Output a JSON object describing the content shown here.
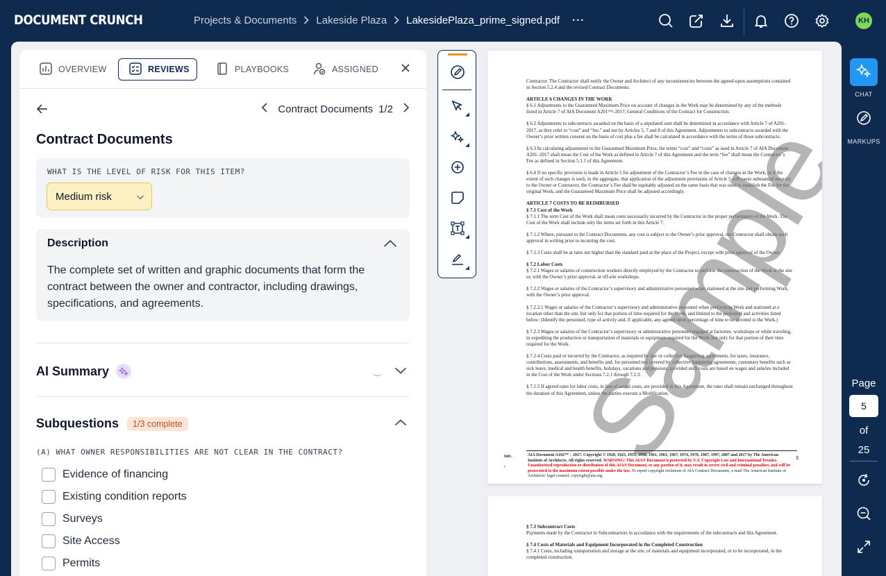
{
  "app": {
    "logo": "DOCUMENT CRUNCH",
    "breadcrumb": [
      "Projects & Documents",
      "Lakeside Plaza",
      "LakesidePlaza_prime_signed.pdf"
    ],
    "more": "···",
    "user_initials": "KH"
  },
  "panel": {
    "tabs": [
      {
        "label": "OVERVIEW",
        "icon": "chart-icon"
      },
      {
        "label": "REVIEWS",
        "icon": "review-icon"
      },
      {
        "label": "PLAYBOOKS",
        "icon": "book-icon"
      },
      {
        "label": "ASSIGNED",
        "icon": "user-check-icon"
      }
    ],
    "active_tab": "REVIEWS",
    "pager_label": "Contract Documents",
    "pager_count": "1/2",
    "title": "Contract Documents",
    "risk_question": "WHAT IS THE LEVEL OF RISK FOR THIS ITEM?",
    "risk_value": "Medium risk",
    "description_heading": "Description",
    "description_text": "The complete set of written and graphic documents that form the contract between the owner and contractor, including drawings, specifications, and agreements.",
    "ai_summary_heading": "AI Summary",
    "subquestions_heading": "Subquestions",
    "subquestions_badge": "1/3 complete",
    "subquestion_a": "(A) WHAT OWNER RESPONSIBILITIES ARE NOT CLEAR IN THE CONTRACT?",
    "checklist": [
      "Evidence of financing",
      "Existing condition reports",
      "Surveys",
      "Site Access",
      "Permits"
    ]
  },
  "document": {
    "watermark": "Sample",
    "page1_paragraphs": [
      "Contractor. The Contractor shall notify the Owner and Architect of any inconsistencies between the agreed-upon assumptions contained in Section 5.2.4 and the revised Contract Documents.",
      "ARTICLE 6   CHANGES IN THE WORK",
      "§ 6.1 Adjustments to the Guaranteed Maximum Price on account of changes in the Work may be determined by any of the methods listed in Article 7 of AIA Document A201™–2017, General Conditions of the Contract for Construction.",
      "§ 6.2 Adjustments to subcontracts awarded on the basis of a stipulated sum shall be determined in accordance with Article 7 of A201–2017, as they refer to “cost” and “fee,” and not by Articles 5, 7 and 8 of this Agreement. Adjustments to subcontracts awarded with the Owner’s prior written consent on the basis of cost plus a fee shall be calculated in accordance with the terms of those subcontracts.",
      "§ 6.3 In calculating adjustments to the Guaranteed Maximum Price, the terms “cost” and “costs” as used in Article 7 of AIA Document A201–2017 shall mean the Cost of the Work as defined in Article 7 of this Agreement and the term “fee” shall mean the Contractor’s Fee as defined in Section 5.1.1 of this Agreement.",
      "§ 6.4 If no specific provision is made in Article 5 for adjustment of the Contractor’s Fee in the case of changes in the Work, or if the extent of such changes is such, in the aggregate, that application of the adjustment provisions of Article 5 will cause substantial inequity to the Owner or Contractor, the Contractor’s Fee shall be equitably adjusted on the same basis that was used to establish the Fee for the original Work, and the Guaranteed Maximum Price shall be adjusted accordingly.",
      "ARTICLE 7   COSTS TO BE REIMBURSED",
      "§ 7.1 Cost of the Work",
      "§ 7.1.1 The term Cost of the Work shall mean costs necessarily incurred by the Contractor in the proper performance of the Work. The Cost of the Work shall include only the items set forth in this Article 7.",
      "§ 7.1.2 Where, pursuant to the Contract Documents, any cost is subject to the Owner’s prior approval, the Contractor shall obtain such approval in writing prior to incurring the cost.",
      "§ 7.1.3 Costs shall be at rates not higher than the standard paid at the place of the Project, except with prior approval of the Owner.",
      "§ 7.2 Labor Costs",
      "§ 7.2.1 Wages or salaries of construction workers directly employed by the Contractor to perform the construction of the Work at the site or, with the Owner’s prior approval, at off-site workshops.",
      "§ 7.2.2 Wages or salaries of the Contractor’s supervisory and administrative personnel when stationed at the site and performing Work, with the Owner’s prior approval.",
      "§ 7.2.2.1 Wages or salaries of the Contractor’s supervisory and administrative personnel when performing Work and stationed at a location other than the site, but only for that portion of time required for the Work, and limited to the personnel and activities listed below: (Identify the personnel, type of activity and, if applicable, any agreed upon percentage of time to be devoted to the Work.)",
      "§ 7.2.3 Wages or salaries of the Contractor’s supervisory or administrative personnel engaged at factories, workshops or while traveling, in expediting the production or transportation of materials or equipment required for the Work, but only for that portion of their time required for the Work.",
      "§ 7.2.4 Costs paid or incurred by the Contractor, as required by law or collective bargaining agreements, for taxes, insurance, contributions, assessments, and benefits and, for personnel not covered by collective bargaining agreements, customary benefits such as sick leave, medical and health benefits, holidays, vacations and pensions, provided such costs are based on wages and salaries included in the Cost of the Work under Sections 7.2.1 through 7.2.3.",
      "§ 7.2.5 If agreed rates for labor costs, in lieu of actual costs, are provided in this Agreement, the rates shall remain unchanged throughout the duration of this Agreement, unless the parties execute a Modification."
    ],
    "footer_init": "Init.",
    "footer_slash": "/",
    "footer_text": "AIA Document A102™ – 2017. Copyright © 1920, 1925, 1951, 1958, 1961, 1963, 1967, 1974, 1978, 1987, 1997, 2007 and 2017 by The American Institute of Architects. All rights reserved.",
    "footer_warning": "WARNING: This AIA® Document is protected by U.S. Copyright Law and International Treaties. Unauthorized reproduction or distribution of this AIA® Document, or any portion of it, may result in severe civil and criminal penalties, and will be prosecuted to the maximum extent possible under the law.",
    "footer_tail": "To report copyright violations of AIA Contract Documents, e-mail The American Institute of Architects’ legal counsel, copyright@aia.org.",
    "page_number": "5",
    "page2_paragraphs": [
      "§ 7.3 Subcontract Costs",
      "Payments made by the Contractor to Subcontractors in accordance with the requirements of the subcontracts and this Agreement.",
      "§ 7.4 Costs of Materials and Equipment Incorporated in the Completed Construction",
      "§ 7.4.1 Costs, including transportation and storage at the site, of materials and equipment incorporated, or to be incorporated, in the completed construction."
    ]
  },
  "rail": {
    "chat_label": "CHAT",
    "markups_label": "MARKUPS",
    "page_label": "Page",
    "page_value": "5",
    "of_label": "of",
    "total_pages": "25"
  }
}
